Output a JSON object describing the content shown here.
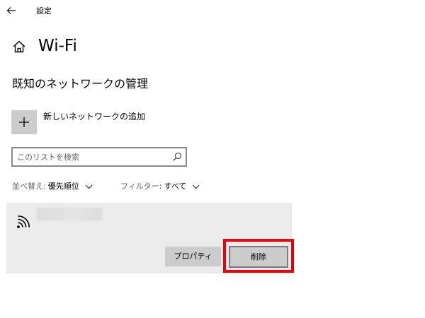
{
  "window": {
    "title": "設定"
  },
  "header": {
    "title": "Wi-Fi",
    "home_icon": "home-icon"
  },
  "section": {
    "title": "既知のネットワークの管理"
  },
  "add_network": {
    "label": "新しいネットワークの追加",
    "icon": "plus-icon"
  },
  "search": {
    "placeholder": "このリストを検索",
    "value": "",
    "icon": "search-icon"
  },
  "sort": {
    "label": "並べ替え:",
    "value": "優先順位"
  },
  "filter": {
    "label": "フィルター:",
    "value": "すべて"
  },
  "network": {
    "icon": "wifi-icon",
    "name": "",
    "name_obscured": true,
    "buttons": {
      "properties": "プロパティ",
      "delete": "削除"
    }
  },
  "colors": {
    "highlight": "#e8000b",
    "button_bg": "#cccccc",
    "card_bg": "#ebebeb"
  }
}
